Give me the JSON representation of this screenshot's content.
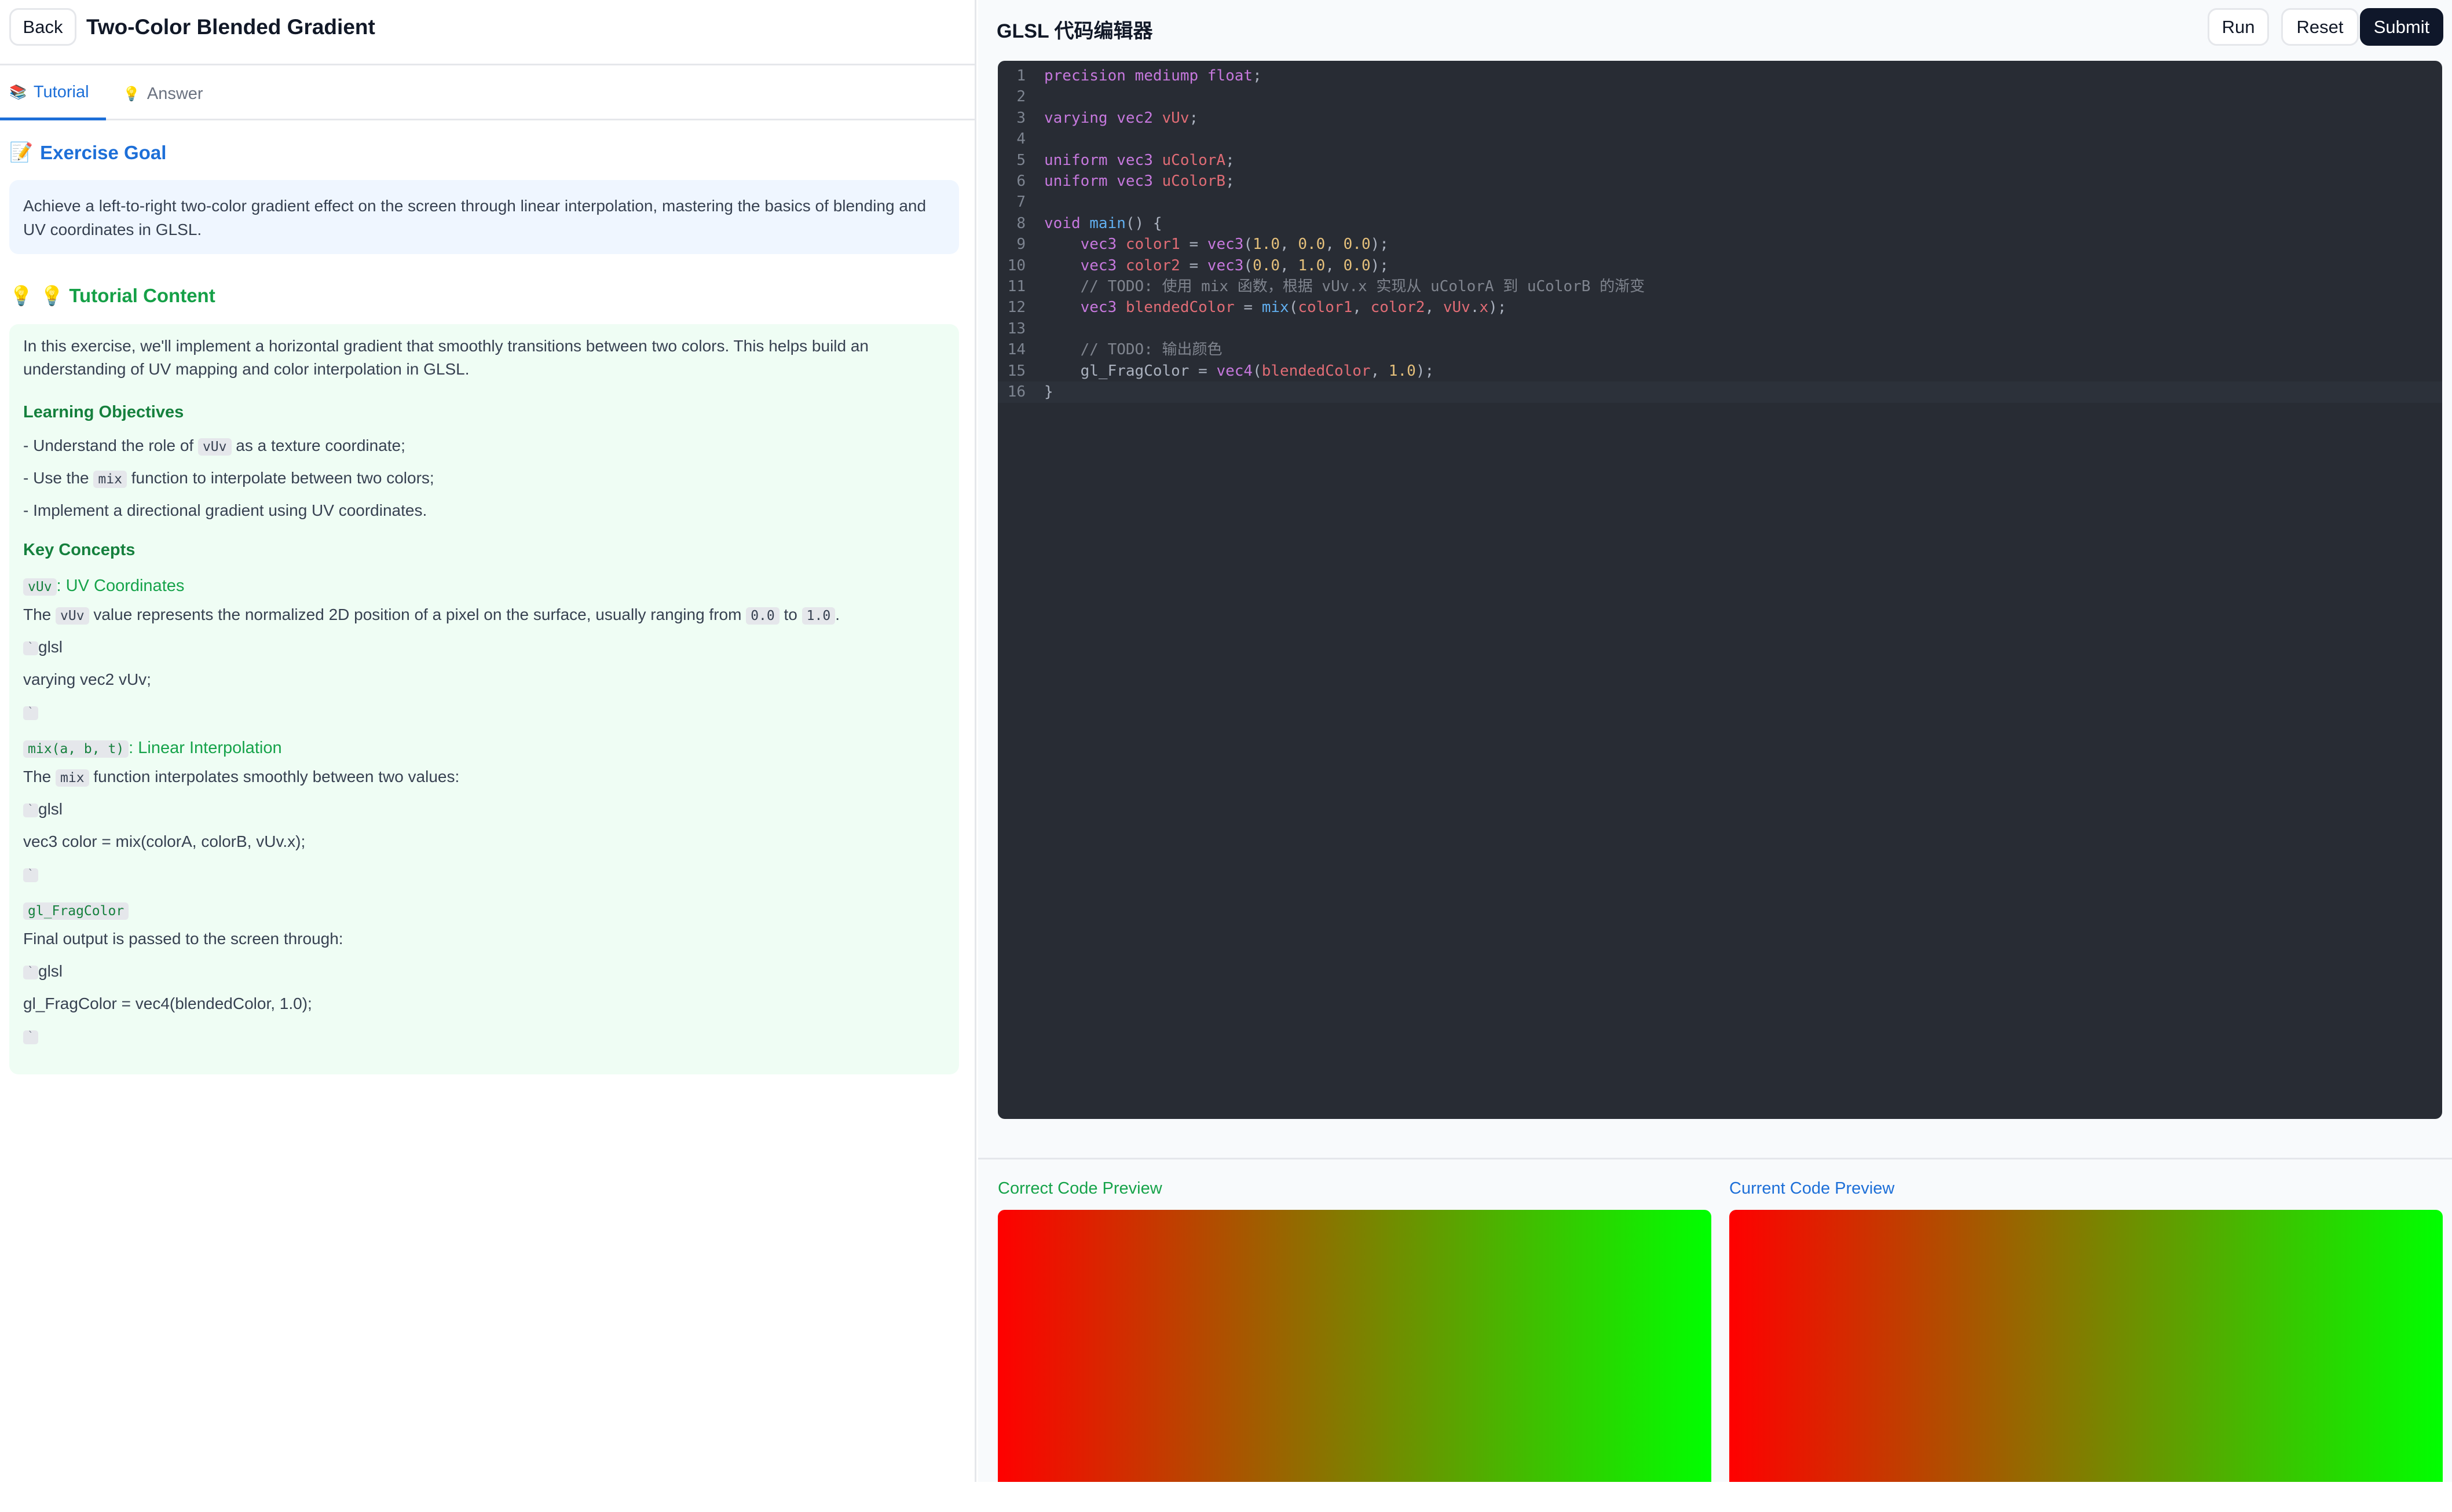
{
  "header": {
    "back_label": "Back",
    "title": "Two-Color Blended Gradient"
  },
  "tabs": [
    {
      "label": "Tutorial",
      "icon": "books-icon",
      "active": true
    },
    {
      "label": "Answer",
      "icon": "lightbulb-icon",
      "active": false
    }
  ],
  "goal": {
    "title": "Exercise Goal",
    "text": "Achieve a left-to-right two-color gradient effect on the screen through linear interpolation, mastering the basics of blending and UV coordinates in GLSL."
  },
  "tutorial": {
    "title": "💡 Tutorial Content",
    "intro": "In this exercise, we'll implement a horizontal gradient that smoothly transitions between two colors. This helps build an understanding of UV mapping and color interpolation in GLSL.",
    "objectives_title": "Learning Objectives",
    "obj1_a": "- Understand the role of ",
    "obj1_code": "vUv",
    "obj1_b": " as a texture coordinate;",
    "obj2_a": "- Use the ",
    "obj2_code": "mix",
    "obj2_b": " function to interpolate between two colors;",
    "obj3": "- Implement a directional gradient using UV coordinates.",
    "concepts_title": "Key Concepts",
    "c1_code": "vUv",
    "c1_title": ": UV Coordinates",
    "c1_a": "The ",
    "c1_code2": "vUv",
    "c1_b": " value represents the normalized 2D position of a pixel on the surface, usually ranging from ",
    "c1_from": "0.0",
    "c1_to_word": " to ",
    "c1_to": "1.0",
    "c1_end": ".",
    "glsl_word": "glsl",
    "c1_snippet": "varying vec2 vUv;",
    "c2_code": "mix(a, b, t)",
    "c2_title": ": Linear Interpolation",
    "c2_a": "The ",
    "c2_code2": "mix",
    "c2_b": " function interpolates smoothly between two values:",
    "c2_snippet": "vec3 color = mix(colorA, colorB, vUv.x);",
    "c3_code": "gl_FragColor",
    "c3_text": "Final output is passed to the screen through:",
    "c3_snippet": "gl_FragColor = vec4(blendedColor, 1.0);",
    "backtick": "`"
  },
  "editor": {
    "title": "GLSL 代码编辑器",
    "run_label": "Run",
    "reset_label": "Reset",
    "submit_label": "Submit",
    "lines": [
      "precision mediump float;",
      "",
      "varying vec2 vUv;",
      "",
      "uniform vec3 uColorA;",
      "uniform vec3 uColorB;",
      "",
      "void main() {",
      "    vec3 color1 = vec3(1.0, 0.0, 0.0);",
      "    vec3 color2 = vec3(0.0, 1.0, 0.0);",
      "    // TODO: 使用 mix 函数，根据 vUv.x 实现从 uColorA 到 uColorB 的渐变",
      "    vec3 blendedColor = mix(color1, color2, vUv.x);",
      "",
      "    // TODO: 输出颜色",
      "    gl_FragColor = vec4(blendedColor, 1.0);",
      "}"
    ],
    "active_line": 16
  },
  "preview": {
    "correct_label": "Correct Code Preview",
    "current_label": "Current Code Preview",
    "gradient_colors": [
      "#ff0000",
      "#00ff00"
    ]
  }
}
